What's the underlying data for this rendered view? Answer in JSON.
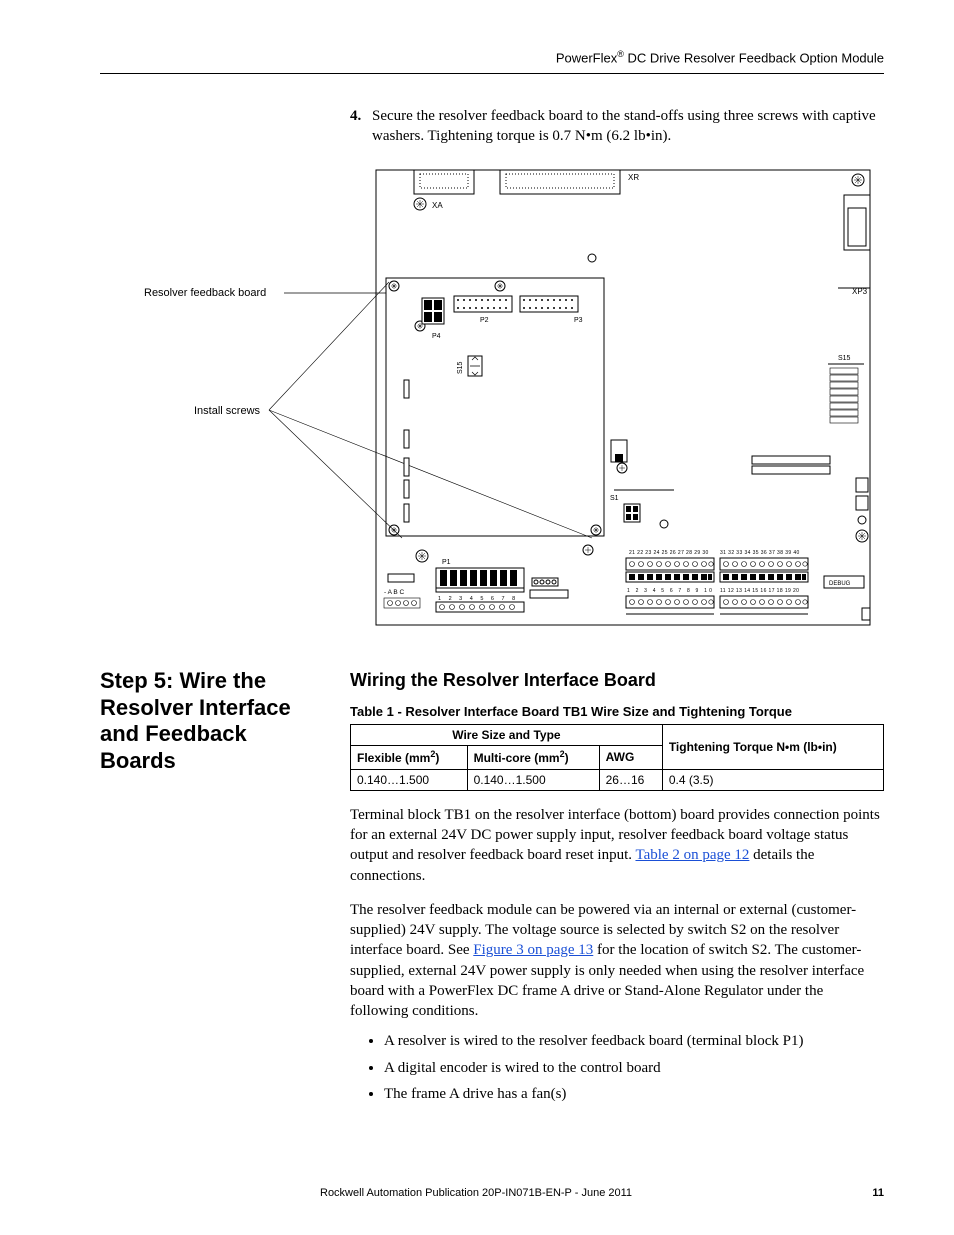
{
  "header": {
    "product_prefix": "PowerFlex",
    "product_suffix": " DC Drive Resolver Feedback Option Module",
    "reg_mark": "®"
  },
  "step4": {
    "number": "4.",
    "text_a": "Secure the resolver feedback board to the stand-offs using three screws with captive washers. Tightening torque is 0.7 N",
    "bullet1": "•",
    "text_b": "m (6.2 lb",
    "bullet2": "•",
    "text_c": "in)."
  },
  "diagram": {
    "label_resolver": "Resolver feedback board",
    "label_install": "Install screws",
    "XR": "XR",
    "XA": "XA",
    "XP3": "XP3",
    "P4": "P4",
    "P2": "P2",
    "P3": "P3",
    "S15_lbl": "S15",
    "S1_lbl": "S1",
    "S15v": "S15",
    "P1": "P1",
    "DEBUG": "DEBUG",
    "ABC": "- A B C",
    "nums_1_8": "1 2 3 4 5 6 7 8",
    "nums_1_10": "1 2 3 4 5 6 7 8 9 10",
    "nums_11_20": "11 12 13 14 15 16 17 18 19 20",
    "nums_21_30": "21 22 23 24 25 26 27 28 29 30",
    "nums_31_40": "31 32 33 34 35 36 37 38 39 40"
  },
  "step5": {
    "heading": "Step 5:  Wire the Resolver Interface and Feedback Boards",
    "sub_heading": "Wiring the Resolver Interface Board",
    "table_title": "Table 1 - Resolver Interface Board TB1 Wire Size and Tightening Torque",
    "table": {
      "col_group": "Wire Size and Type",
      "col_flex_a": "Flexible (mm",
      "col_flex_b": ")",
      "col_multi_a": "Multi-core (mm",
      "col_multi_b": ")",
      "sup2": "2",
      "col_awg": "AWG",
      "col_torque": "Tightening Torque N•m (lb•in)",
      "row1": {
        "flex": "0.140…1.500",
        "multi": "0.140…1.500",
        "awg": "26…16",
        "torque": "0.4 (3.5)"
      }
    },
    "para1_a": "Terminal block TB1 on the resolver interface (bottom) board provides connection points for an external 24V DC power supply input, resolver feedback board voltage status output and resolver feedback board reset input. ",
    "para1_link": "Table 2 on page 12",
    "para1_b": " details the connections.",
    "para2_a": "The resolver feedback module can be powered via an internal or external (customer-supplied) 24V supply. The voltage source is selected by switch S2 on the resolver interface board. See ",
    "para2_link": "Figure 3 on page 13",
    "para2_b": " for the location of switch S2. The customer-supplied, external 24V power supply is only needed when using the resolver interface board with a PowerFlex DC frame A drive or Stand-Alone Regulator under the following conditions.",
    "bullets": {
      "b1": "A resolver is wired to the resolver feedback board (terminal block P1)",
      "b2": "A digital encoder is wired to the control board",
      "b3": "The frame A drive has a fan(s)"
    }
  },
  "footer": {
    "pub": "Rockwell Automation Publication 20P-IN071B-EN-P - June 2011",
    "page": "11"
  }
}
